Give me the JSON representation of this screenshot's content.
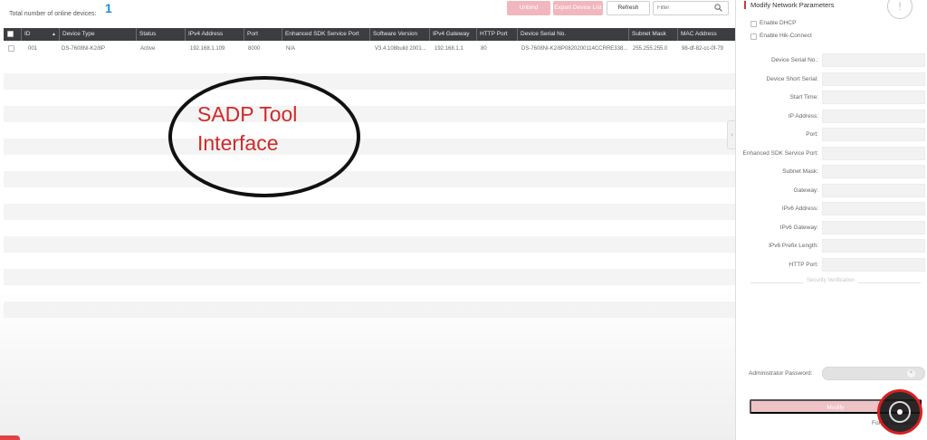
{
  "header": {
    "total_label": "Total number of online devices:",
    "total_count": "1",
    "buttons": {
      "unbind": "Unbind",
      "export": "Export Device List",
      "refresh": "Refresh"
    },
    "filter_placeholder": "Filter"
  },
  "table": {
    "columns": [
      "ID",
      "Device Type",
      "Status",
      "IPv4 Address",
      "Port",
      "Enhanced SDK Service Port",
      "Software Version",
      "IPv4 Gateway",
      "HTTP Port",
      "Device Serial No.",
      "Subnet Mask",
      "MAC Address"
    ],
    "rows": [
      {
        "id": "001",
        "device_type": "DS-7608NI-K2/8P",
        "status": "Active",
        "ipv4": "192.168.1.109",
        "port": "8000",
        "sdk_port": "N/A",
        "software": "V3.4.108build 2001...",
        "gateway": "192.168.1.1",
        "http_port": "80",
        "serial": "DS-7608NI-K2/8P0820200114CCRRE338...",
        "subnet": "255.255.255.0",
        "mac": "98-df-82-cc-0f-79"
      }
    ]
  },
  "annotation": {
    "line1": "SADP Tool",
    "line2": "Interface"
  },
  "panel": {
    "title": "Modify Network Parameters",
    "help_glyph": "!",
    "collapse_glyph": "›",
    "enable_dhcp": "Enable DHCP",
    "enable_hik": "Enable Hik-Connect",
    "fields": [
      "Device Serial No.:",
      "Device Short Serial:",
      "Start Time:",
      "IP Address:",
      "Port:",
      "Enhanced SDK Service Port:",
      "Subnet Mask:",
      "Gateway:",
      "IPv6 Address:",
      "IPv6 Gateway:",
      "IPv6 Prefix Length:",
      "HTTP Port:"
    ],
    "security_label": "Security Verification",
    "admin_password_label": "Administrator Password:",
    "clear_glyph": "×",
    "modify_label": "Modify",
    "forgot_label": "Forgot Password"
  },
  "colors": {
    "accent": "#1e90d8",
    "header_bg": "#3b3d40",
    "primary_disabled": "#f1b7be",
    "annotation_text": "#d02a2a",
    "recording": "#d82020"
  }
}
